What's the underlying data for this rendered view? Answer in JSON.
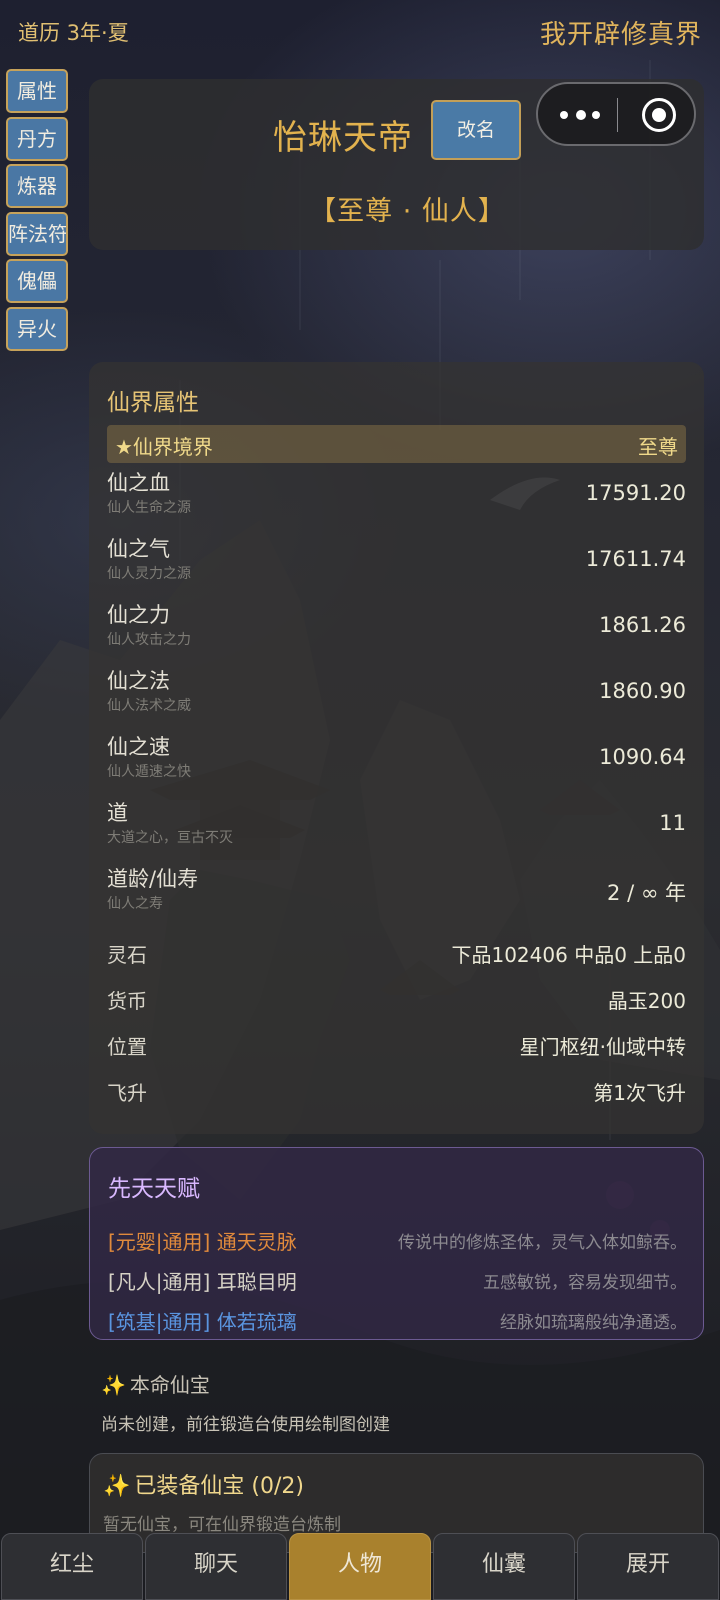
{
  "header": {
    "calendar": "道历 3年·夏",
    "app_title": "我开辟修真界"
  },
  "sidenav": {
    "items": [
      "属性",
      "丹方",
      "炼器",
      "阵法符",
      "傀儡",
      "异火"
    ]
  },
  "profile": {
    "name": "怡琳天帝",
    "rename_label": "改名",
    "rank": "【至尊 · 仙人】"
  },
  "capsule": {
    "more_icon": "more-dots-icon",
    "close_icon": "target-circle-icon"
  },
  "attributes": {
    "title": "仙界属性",
    "realm": {
      "label": "★仙界境界",
      "value": "至尊"
    },
    "stats": [
      {
        "label": "仙之血",
        "desc": "仙人生命之源",
        "value": "17591.20"
      },
      {
        "label": "仙之气",
        "desc": "仙人灵力之源",
        "value": "17611.74"
      },
      {
        "label": "仙之力",
        "desc": "仙人攻击之力",
        "value": "1861.26"
      },
      {
        "label": "仙之法",
        "desc": "仙人法术之威",
        "value": "1860.90"
      },
      {
        "label": "仙之速",
        "desc": "仙人遁速之快",
        "value": "1090.64"
      },
      {
        "label": "道",
        "desc": "大道之心，亘古不灭",
        "value": "11"
      },
      {
        "label": "道龄/仙寿",
        "desc": "仙人之寿",
        "value": "2 / ∞ 年"
      }
    ],
    "info": [
      {
        "label": "灵石",
        "value": "下品102406  中品0  上品0"
      },
      {
        "label": "货币",
        "value": "晶玉200"
      },
      {
        "label": "位置",
        "value": "星门枢纽·仙域中转"
      },
      {
        "label": "飞升",
        "value": "第1次飞升"
      }
    ]
  },
  "talents": {
    "title": "先天天赋",
    "items": [
      {
        "name": "[元婴|通用] 通天灵脉",
        "desc": "传说中的修炼圣体，灵气入体如鲸吞。",
        "color": "#e08a3c"
      },
      {
        "name": "[凡人|通用] 耳聪目明",
        "desc": "五感敏锐，容易发现细节。",
        "color": "#d6d2c6"
      },
      {
        "name": "[筑基|通用] 体若琉璃",
        "desc": "经脉如琉璃般纯净通透。",
        "color": "#5a95e0"
      }
    ]
  },
  "natal": {
    "icon": "sparkles-icon",
    "title": "本命仙宝",
    "note": "尚未创建，前往锻造台使用绘制图创建"
  },
  "equipped": {
    "icon": "sparkles-icon",
    "title": "已装备仙宝 (0/2)",
    "note": "暂无仙宝，可在仙界锻造台炼制"
  },
  "tabs": [
    {
      "label": "红尘",
      "active": false
    },
    {
      "label": "聊天",
      "active": false
    },
    {
      "label": "人物",
      "active": true
    },
    {
      "label": "仙囊",
      "active": false
    },
    {
      "label": "展开",
      "active": false
    }
  ],
  "colors": {
    "gold": "#e2b24e",
    "nav_blue": "#4a77a4",
    "active_tab": "#a9812d",
    "talent_border": "#6c5a92"
  }
}
